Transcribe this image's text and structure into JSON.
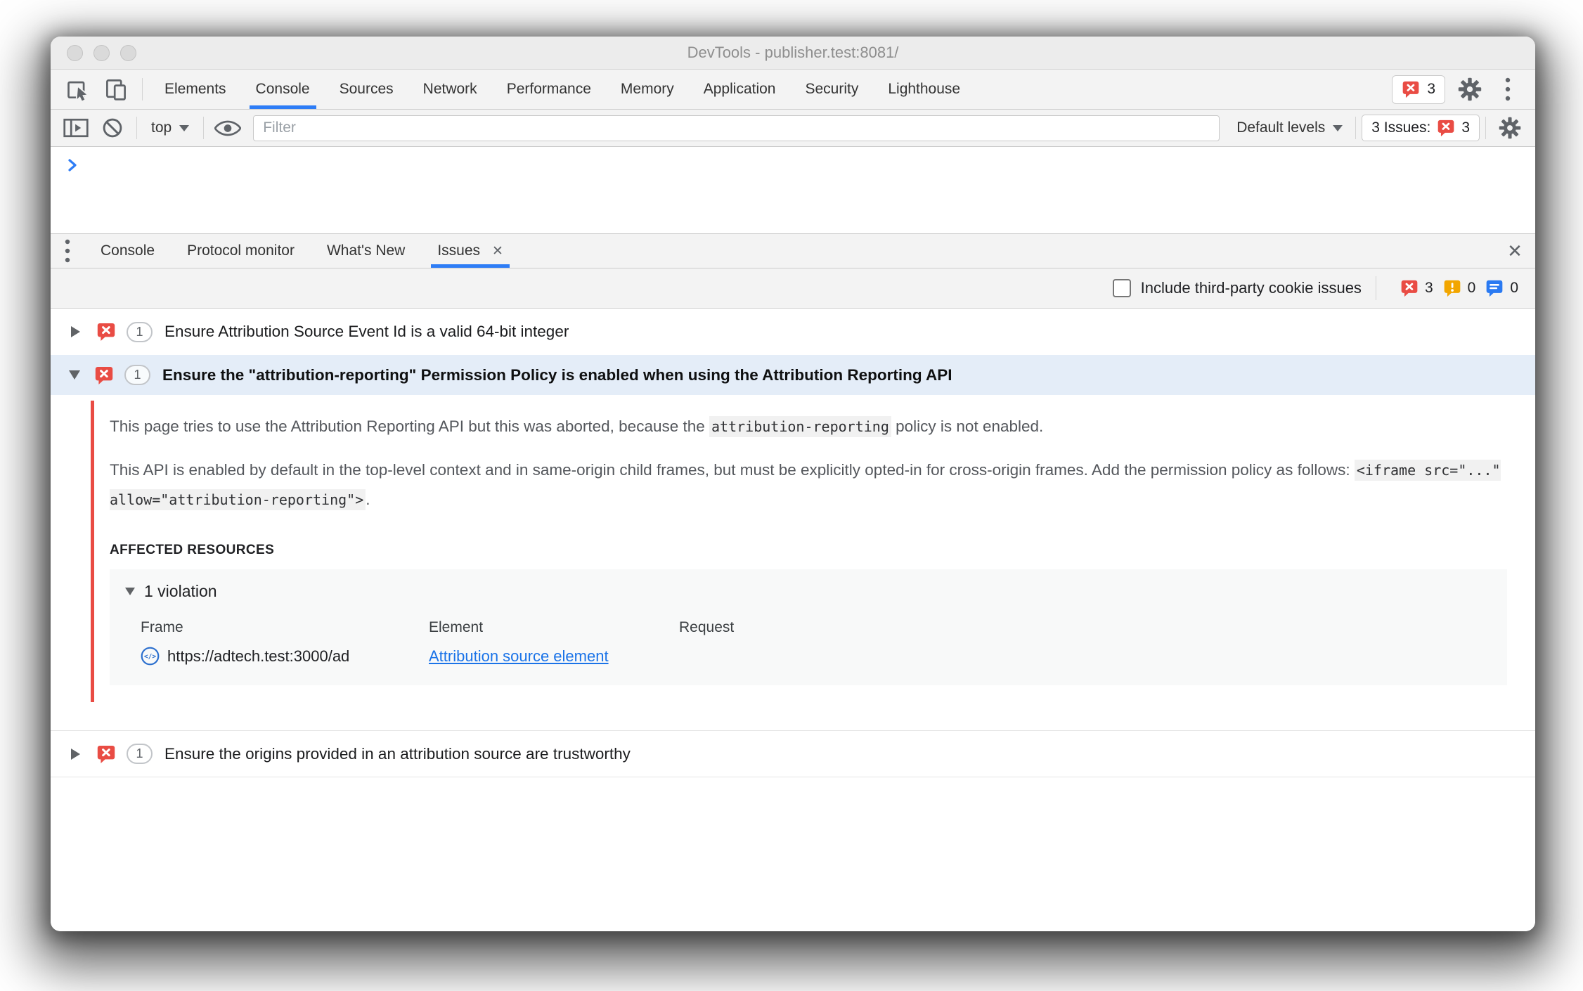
{
  "colors": {
    "accent": "#1a73e8",
    "tab-underline": "#2e7df6",
    "error": "#e94c44",
    "warning": "#f2a600",
    "info": "#2a7af2",
    "selected-row": "#e4edf8"
  },
  "window": {
    "title": "DevTools - publisher.test:8081/"
  },
  "main_tabs": {
    "items": [
      "Elements",
      "Console",
      "Sources",
      "Network",
      "Performance",
      "Memory",
      "Application",
      "Security",
      "Lighthouse"
    ],
    "active": "Console",
    "error_count": "3"
  },
  "console_toolbar": {
    "context_selector": "top",
    "filter_placeholder": "Filter",
    "levels_label": "Default levels",
    "issues_label": "3 Issues:",
    "issues_count": "3"
  },
  "drawer": {
    "tabs": [
      "Console",
      "Protocol monitor",
      "What's New",
      "Issues"
    ],
    "active_tab": "Issues",
    "tab_close_glyph": "✕",
    "drawer_close_glyph": "✕"
  },
  "issues_toolbar": {
    "checkbox_label": "Include third-party cookie issues",
    "error_count": "3",
    "warning_count": "0",
    "info_count": "0"
  },
  "issues": [
    {
      "count": "1",
      "title": "Ensure Attribution Source Event Id is a valid 64-bit integer"
    },
    {
      "count": "1",
      "title": "Ensure the \"attribution-reporting\" Permission Policy is enabled when using the Attribution Reporting API"
    },
    {
      "count": "1",
      "title": "Ensure the origins provided in an attribution source are trustworthy"
    }
  ],
  "issue_detail": {
    "p1_before": "This page tries to use the Attribution Reporting API but this was aborted, because the ",
    "p1_code": "attribution-reporting",
    "p1_after": " policy is not enabled.",
    "p2_before": "This API is enabled by default in the top-level context and in same-origin child frames, but must be explicitly opted-in for cross-origin frames. Add the permission policy as follows: ",
    "p2_code": "<iframe src=\"...\" allow=\"attribution-reporting\">",
    "p2_after": ".",
    "affected_heading": "AFFECTED RESOURCES",
    "violations_label": "1 violation",
    "table": {
      "headers": [
        "Frame",
        "Element",
        "Request"
      ],
      "rows": [
        {
          "frame": "https://adtech.test:3000/ad",
          "element": "Attribution source element",
          "request": ""
        }
      ]
    }
  }
}
